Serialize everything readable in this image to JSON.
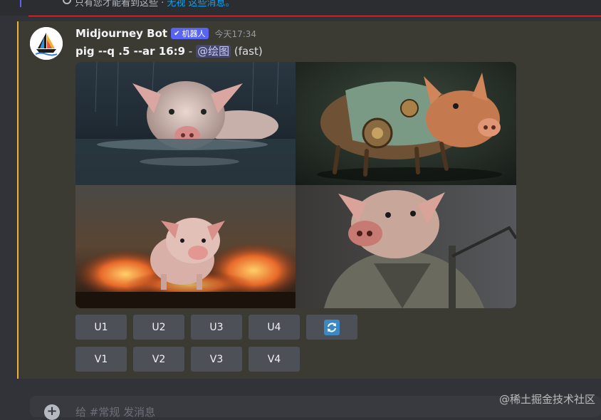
{
  "notice": {
    "text": "只有您才能看到这些 · ",
    "link": "无视 这些消息。"
  },
  "message": {
    "author": "Midjourney Bot",
    "badge": "机器人",
    "timestamp": "今天17:34",
    "prompt_command": "pig --q .5 --ar 16:9",
    "prompt_separator": " - ",
    "mention": "@绘图",
    "speed": " (fast)"
  },
  "image_grid": {
    "cells": [
      {
        "name": "pig-in-water"
      },
      {
        "name": "steampunk-pig"
      },
      {
        "name": "pig-in-fire"
      },
      {
        "name": "pig-warrior"
      }
    ]
  },
  "buttons": {
    "upscale": [
      "U1",
      "U2",
      "U3",
      "U4"
    ],
    "reroll_icon": "refresh-icon",
    "variation": [
      "V1",
      "V2",
      "V3",
      "V4"
    ]
  },
  "composer": {
    "placeholder": "给 #常规 发消息"
  },
  "watermark": "@稀土掘金技术社区",
  "colors": {
    "background": "#313338",
    "message_highlight": "#3b3a33",
    "highlight_bar": "#f0b232",
    "badge": "#5865f2",
    "button": "#4e5058",
    "link": "#00a8fc"
  }
}
